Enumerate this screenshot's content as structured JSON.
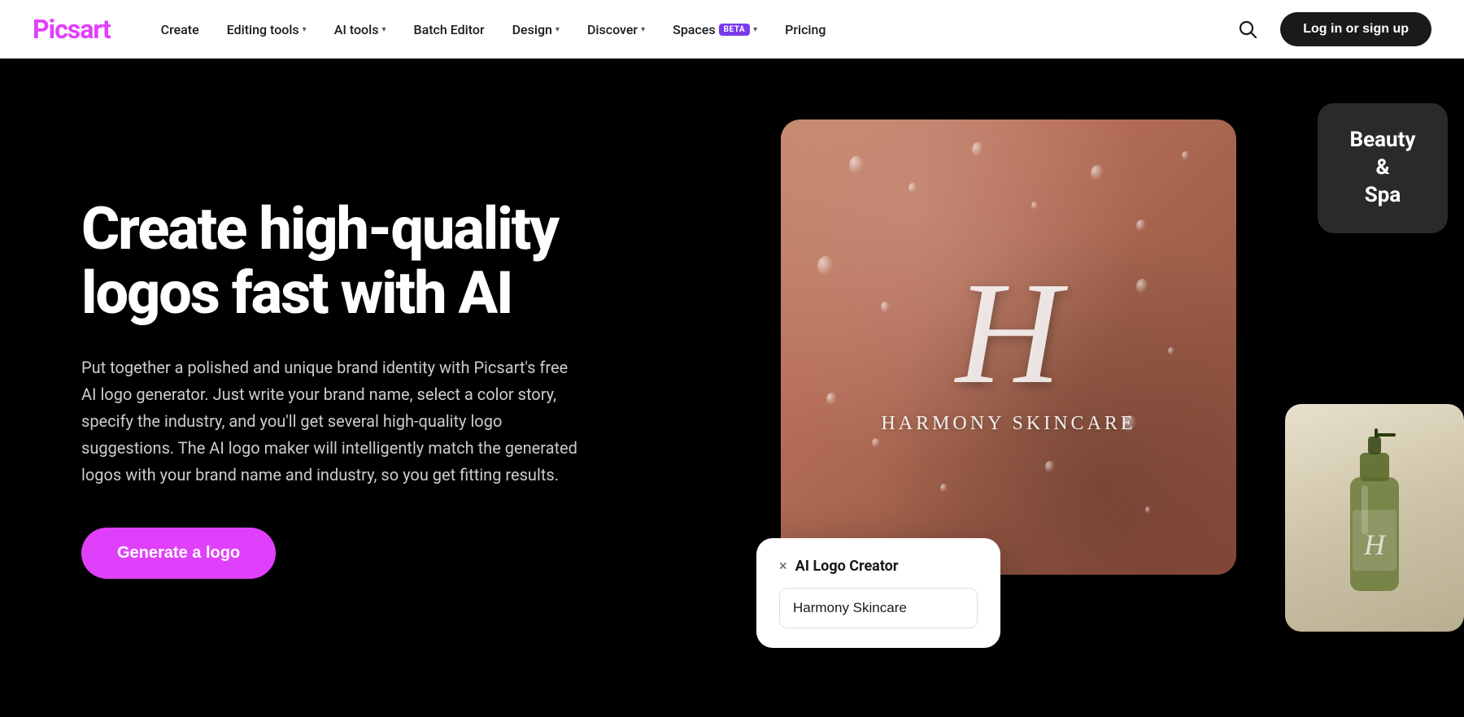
{
  "nav": {
    "logo": "Picsart",
    "links": [
      {
        "label": "Create",
        "has_dropdown": false
      },
      {
        "label": "Editing tools",
        "has_dropdown": true
      },
      {
        "label": "AI tools",
        "has_dropdown": true
      },
      {
        "label": "Batch Editor",
        "has_dropdown": false
      },
      {
        "label": "Design",
        "has_dropdown": true
      },
      {
        "label": "Discover",
        "has_dropdown": true
      },
      {
        "label": "Spaces",
        "has_dropdown": true,
        "badge": "BETA"
      },
      {
        "label": "Pricing",
        "has_dropdown": false
      }
    ],
    "login_label": "Log in or sign up"
  },
  "hero": {
    "title": "Create high-quality logos fast with AI",
    "description": "Put together a polished and unique brand identity with Picsart's free AI logo generator. Just write your brand name, select a color story, specify the industry, and you'll get several high-quality logo suggestions. The AI logo maker will intelligently match the generated logos with your brand name and industry, so you get fitting results.",
    "cta_label": "Generate a logo"
  },
  "logo_card": {
    "letter": "H",
    "brand_name": "Harmony Skincare"
  },
  "beauty_spa_card": {
    "text": "Beauty\n&\nSpa"
  },
  "ai_popup": {
    "title": "AI Logo Creator",
    "input_value": "Harmony Skincare",
    "close_label": "×"
  },
  "colors": {
    "brand_pink": "#e040fb",
    "dark_bg": "#000000",
    "nav_bg": "#ffffff",
    "login_bg": "#1a1a1a"
  }
}
